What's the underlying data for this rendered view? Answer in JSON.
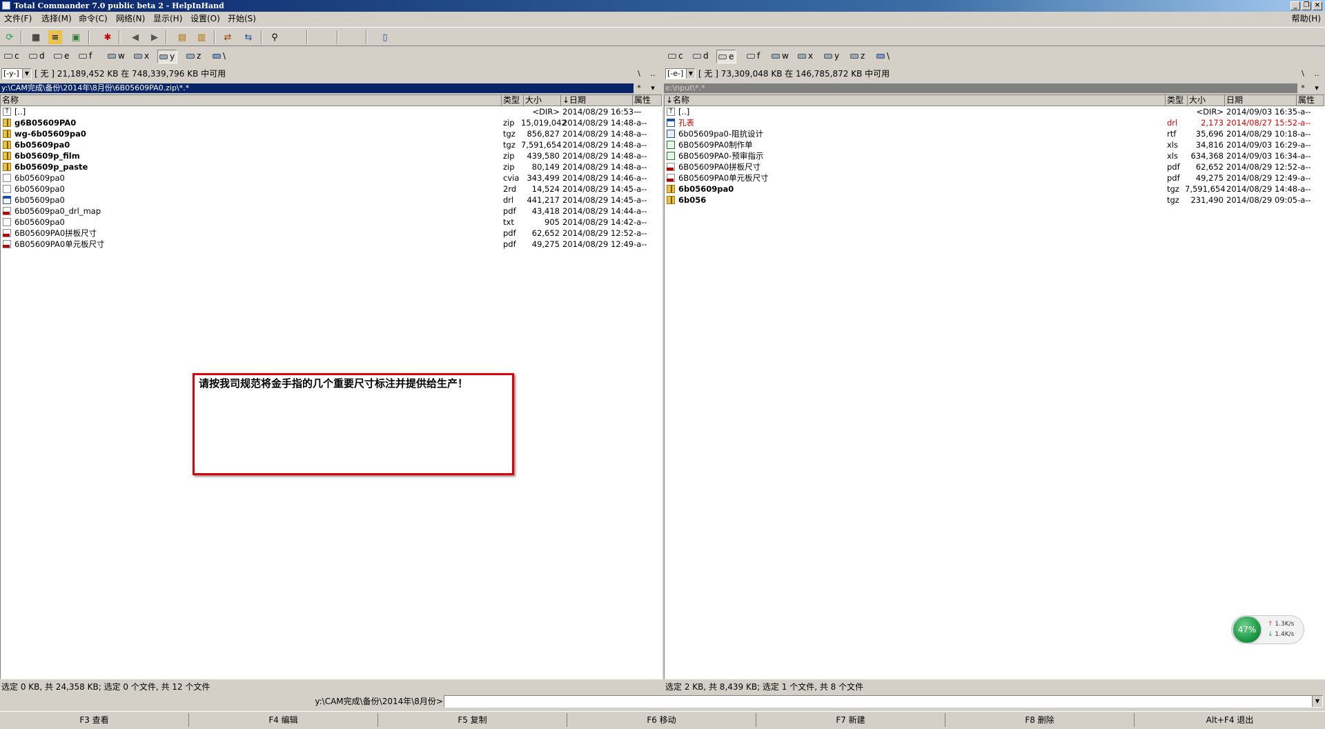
{
  "window": {
    "title": "Total Commander 7.0 public beta 2 - HelpInHand"
  },
  "menu": {
    "items": [
      "文件(F)",
      "选择(M)",
      "命令(C)",
      "网络(N)",
      "显示(H)",
      "设置(O)",
      "开始(S)"
    ],
    "help": "帮助(H)"
  },
  "left": {
    "drives": [
      "c",
      "d",
      "e",
      "f",
      "w",
      "x",
      "y",
      "z",
      "\\"
    ],
    "active_drive": "y",
    "drive_combo": "[-y-]",
    "free_info": "[ 无 ]  21,189,452 KB 在 748,339,796 KB 中可用",
    "path": "y:\\CAM完成\\备份\\2014年\\8月份\\6B05609PA0.zip\\*.*",
    "headers": {
      "name": "名称",
      "ext": "类型",
      "size": "大小",
      "date": "↓日期",
      "attr": "属性"
    },
    "files": [
      {
        "name": "[..]",
        "ext": "",
        "size": "<DIR>",
        "date": "2014/08/29 16:53—",
        "icon": "up",
        "bold": false
      },
      {
        "name": "g6B05609PA0",
        "ext": "zip",
        "size": "15,019,042",
        "date": "2014/08/29 14:48-a--",
        "icon": "zip",
        "bold": true
      },
      {
        "name": "wg-6b05609pa0",
        "ext": "tgz",
        "size": "856,827",
        "date": "2014/08/29 14:48-a--",
        "icon": "zip",
        "bold": true
      },
      {
        "name": "6b05609pa0",
        "ext": "tgz",
        "size": "7,591,654",
        "date": "2014/08/29 14:48-a--",
        "icon": "zip",
        "bold": true
      },
      {
        "name": "6b05609p_film",
        "ext": "zip",
        "size": "439,580",
        "date": "2014/08/29 14:48-a--",
        "icon": "zip",
        "bold": true
      },
      {
        "name": "6b05609p_paste",
        "ext": "zip",
        "size": "80,149",
        "date": "2014/08/29 14:48-a--",
        "icon": "zip",
        "bold": true
      },
      {
        "name": "6b05609pa0",
        "ext": "cvia",
        "size": "343,499",
        "date": "2014/08/29 14:46-a--",
        "icon": "doc",
        "bold": false
      },
      {
        "name": "6b05609pa0",
        "ext": "2rd",
        "size": "14,524",
        "date": "2014/08/29 14:45-a--",
        "icon": "doc",
        "bold": false
      },
      {
        "name": "6b05609pa0",
        "ext": "drl",
        "size": "441,217",
        "date": "2014/08/29 14:45-a--",
        "icon": "drl",
        "bold": false
      },
      {
        "name": "6b05609pa0_drl_map",
        "ext": "pdf",
        "size": "43,418",
        "date": "2014/08/29 14:44-a--",
        "icon": "pdf",
        "bold": false
      },
      {
        "name": "6b05609pa0",
        "ext": "txt",
        "size": "905",
        "date": "2014/08/29 14:42-a--",
        "icon": "doc",
        "bold": false
      },
      {
        "name": "6B05609PA0拼板尺寸",
        "ext": "pdf",
        "size": "62,652",
        "date": "2014/08/29 12:52-a--",
        "icon": "pdf",
        "bold": false
      },
      {
        "name": "6B05609PA0单元板尺寸",
        "ext": "pdf",
        "size": "49,275",
        "date": "2014/08/29 12:49-a--",
        "icon": "pdf",
        "bold": false
      }
    ],
    "status": "选定 0 KB, 共 24,358 KB; 选定 0 个文件, 共 12 个文件"
  },
  "right": {
    "drives": [
      "c",
      "d",
      "e",
      "f",
      "w",
      "x",
      "y",
      "z",
      "\\"
    ],
    "active_drive": "e",
    "drive_combo": "[-e-]",
    "free_info": "[ 无 ]  73,309,048 KB 在 146,785,872 KB 中可用",
    "path": "e:\\nput\\*.*",
    "headers": {
      "name": "↓名称",
      "ext": "类型",
      "size": "大小",
      "date": "日期",
      "attr": "属性"
    },
    "files": [
      {
        "name": "[..]",
        "ext": "",
        "size": "<DIR>",
        "date": "2014/09/03 16:35-a--",
        "icon": "up",
        "bold": false,
        "red": false
      },
      {
        "name": "孔表",
        "ext": "drl",
        "size": "2,173",
        "date": "2014/08/27 15:52-a--",
        "icon": "drl",
        "bold": false,
        "red": true
      },
      {
        "name": "6b05609pa0-阻抗设计",
        "ext": "rtf",
        "size": "35,696",
        "date": "2014/08/29 10:18-a--",
        "icon": "rtf",
        "bold": false,
        "red": false
      },
      {
        "name": "6B05609PA0制作单",
        "ext": "xls",
        "size": "34,816",
        "date": "2014/09/03 16:29-a--",
        "icon": "xls",
        "bold": false,
        "red": false
      },
      {
        "name": "6B05609PA0-预审指示",
        "ext": "xls",
        "size": "634,368",
        "date": "2014/09/03 16:34-a--",
        "icon": "xls",
        "bold": false,
        "red": false
      },
      {
        "name": "6B05609PA0拼板尺寸",
        "ext": "pdf",
        "size": "62,652",
        "date": "2014/08/29 12:52-a--",
        "icon": "pdf",
        "bold": false,
        "red": false
      },
      {
        "name": "6B05609PA0单元板尺寸",
        "ext": "pdf",
        "size": "49,275",
        "date": "2014/08/29 12:49-a--",
        "icon": "pdf",
        "bold": false,
        "red": false
      },
      {
        "name": "6b05609pa0",
        "ext": "tgz",
        "size": "7,591,654",
        "date": "2014/08/29 14:48-a--",
        "icon": "zip",
        "bold": true,
        "red": false
      },
      {
        "name": "6b056",
        "ext": "tgz",
        "size": "231,490",
        "date": "2014/08/29 09:05-a--",
        "icon": "zip",
        "bold": true,
        "red": false
      }
    ],
    "status": "选定 2 KB, 共 8,439 KB; 选定 1 个文件, 共 8 个文件"
  },
  "note": {
    "text": "请按我司规范将金手指的几个重要尺寸标注并提供给生产！"
  },
  "net_widget": {
    "percent": "47%",
    "up": "1.3K/s",
    "down": "1.4K/s"
  },
  "command": {
    "prompt": "y:\\CAM完成\\备份\\2014年\\8月份>",
    "value": ""
  },
  "fkeys": [
    "F3 查看",
    "F4 编辑",
    "F5 复制",
    "F6 移动",
    "F7 新建",
    "F8 删除",
    "Alt+F4 退出"
  ]
}
